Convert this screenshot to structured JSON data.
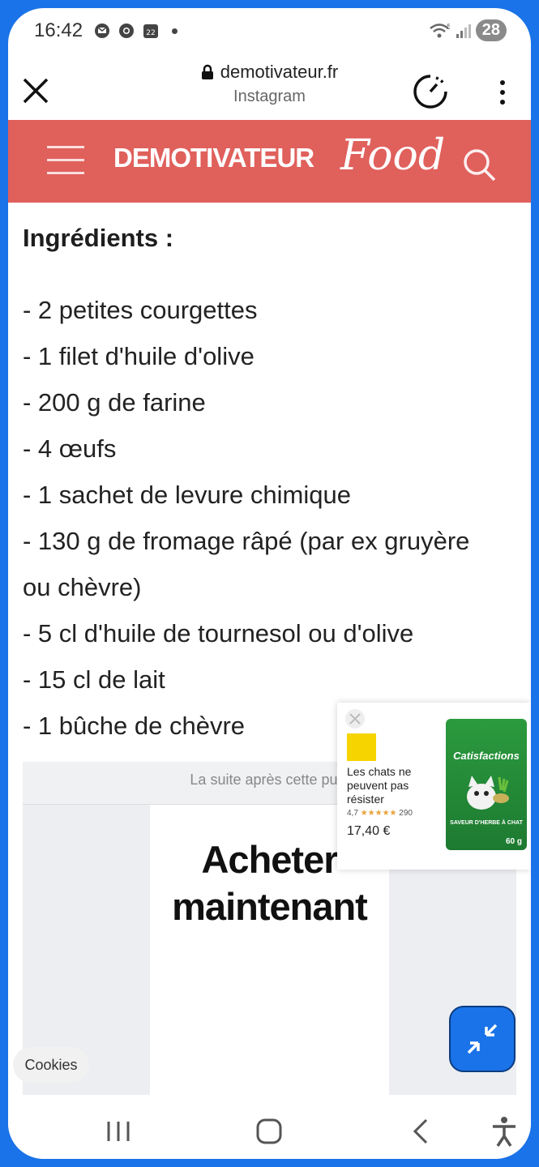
{
  "status_bar": {
    "time": "16:42",
    "battery": "28",
    "network": "5"
  },
  "url_bar": {
    "domain": "demotivateur.fr",
    "subtitle": "Instagram"
  },
  "site_header": {
    "logo": "DEMOTIVATEUR",
    "logo_suffix": "Food"
  },
  "article": {
    "heading": "Ingrédients :",
    "ingredients": [
      "- 2 petites courgettes",
      "- 1 filet d'huile d'olive",
      "- 200 g de farine",
      "- 4 œufs",
      "- 1 sachet de levure chimique",
      "- 130 g de fromage râpé (par ex gruyère",
      "ou chèvre)",
      "- 5 cl d'huile de tournesol ou d'olive",
      "- 15 cl de lait",
      "- 1 bûche de chèvre"
    ]
  },
  "ad": {
    "notice": "La suite après cette publ",
    "cta_line1": "Acheter",
    "cta_line2": "maintenant"
  },
  "floating_ad": {
    "title": "Les chats ne peuvent pas résister",
    "rating": "4,7",
    "stars": "★★★★★",
    "reviews": "290",
    "price": "17,40 €",
    "pack_brand": "Catisfactions",
    "pack_flavor": "SAVEUR D'HERBE À CHAT",
    "pack_weight": "60 g"
  },
  "cookies_label": "Cookies",
  "colors": {
    "header": "#e0605c",
    "accent": "#1a73e8"
  }
}
